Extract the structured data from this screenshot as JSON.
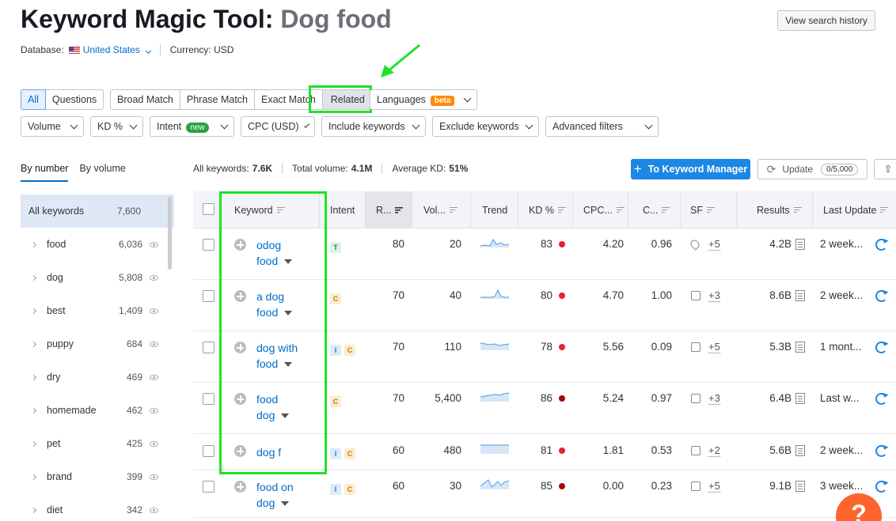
{
  "header": {
    "title_prefix": "Keyword Magic Tool: ",
    "title_query": "Dog food",
    "database_label": "Database:",
    "database_value": "United States",
    "currency": "Currency: USD",
    "history_button": "View search history"
  },
  "match_tabs": {
    "all": "All",
    "questions": "Questions",
    "broad": "Broad Match",
    "phrase": "Phrase Match",
    "exact": "Exact Match",
    "related": "Related",
    "languages": "Languages",
    "beta": "beta"
  },
  "filters": {
    "volume": "Volume",
    "kd": "KD %",
    "intent": "Intent",
    "intent_badge": "new",
    "cpc": "CPC (USD)",
    "include": "Include keywords",
    "exclude": "Exclude keywords",
    "advanced": "Advanced filters"
  },
  "group_tabs": {
    "by_number": "By number",
    "by_volume": "By volume"
  },
  "summary": {
    "all_keywords_label": "All keywords:",
    "all_keywords_value": "7.6K",
    "total_volume_label": "Total volume:",
    "total_volume_value": "4.1M",
    "avg_kd_label": "Average KD:",
    "avg_kd_value": "51%"
  },
  "actions": {
    "to_keyword_manager": "To Keyword Manager",
    "update": "Update",
    "update_quota": "0/5,000"
  },
  "sidebar": {
    "items": [
      {
        "label": "All keywords",
        "count": "7,600"
      },
      {
        "label": "food",
        "count": "6,036"
      },
      {
        "label": "dog",
        "count": "5,808"
      },
      {
        "label": "best",
        "count": "1,409"
      },
      {
        "label": "puppy",
        "count": "684"
      },
      {
        "label": "dry",
        "count": "469"
      },
      {
        "label": "homemade",
        "count": "462"
      },
      {
        "label": "pet",
        "count": "425"
      },
      {
        "label": "brand",
        "count": "399"
      },
      {
        "label": "diet",
        "count": "342"
      }
    ]
  },
  "table": {
    "headers": {
      "keyword": "Keyword",
      "intent": "Intent",
      "results_short": "R...",
      "volume": "Vol...",
      "trend": "Trend",
      "kd": "KD %",
      "cpc": "CPC...",
      "com": "C...",
      "sf": "SF",
      "results": "Results",
      "last_update": "Last Update"
    },
    "rows": [
      {
        "kw1": "odog",
        "kw2": "food",
        "intents": [
          "T"
        ],
        "r": "80",
        "vol": "20",
        "kd": "83",
        "kd_color": "#e8212f",
        "cpc": "4.20",
        "com": "0.96",
        "sf_icon": "pin-icon",
        "sf": "+5",
        "results": "4.2B",
        "updated": "2 week..."
      },
      {
        "kw1": "a dog",
        "kw2": "food",
        "intents": [
          "C"
        ],
        "r": "70",
        "vol": "40",
        "kd": "80",
        "kd_color": "#e8212f",
        "cpc": "4.70",
        "com": "1.00",
        "sf_icon": "article-icon",
        "sf": "+3",
        "results": "8.6B",
        "updated": "2 week..."
      },
      {
        "kw1": "dog with",
        "kw2": "food",
        "intents": [
          "I",
          "C"
        ],
        "r": "70",
        "vol": "110",
        "kd": "78",
        "kd_color": "#e8212f",
        "cpc": "5.56",
        "com": "0.09",
        "sf_icon": "image-icon",
        "sf": "+5",
        "results": "5.3B",
        "updated": "1 mont..."
      },
      {
        "kw1": "food",
        "kw2": "dog",
        "intents": [
          "C"
        ],
        "r": "70",
        "vol": "5,400",
        "kd": "86",
        "kd_color": "#a10a0a",
        "cpc": "5.24",
        "com": "0.97",
        "sf_icon": "image-icon",
        "sf": "+3",
        "results": "6.4B",
        "updated": "Last w..."
      },
      {
        "kw1": "dog f",
        "kw2": "",
        "intents": [
          "I",
          "C"
        ],
        "r": "60",
        "vol": "480",
        "kd": "81",
        "kd_color": "#e8212f",
        "cpc": "1.81",
        "com": "0.53",
        "sf_icon": "image-icon",
        "sf": "+2",
        "results": "5.6B",
        "updated": "2 week..."
      },
      {
        "kw1": "food on",
        "kw2": "dog",
        "intents": [
          "I",
          "C"
        ],
        "r": "60",
        "vol": "30",
        "kd": "85",
        "kd_color": "#a10a0a",
        "cpc": "0.00",
        "com": "0.23",
        "sf_icon": "image-icon",
        "sf": "+5",
        "results": "9.1B",
        "updated": "3 week..."
      }
    ]
  },
  "help_button": "?"
}
